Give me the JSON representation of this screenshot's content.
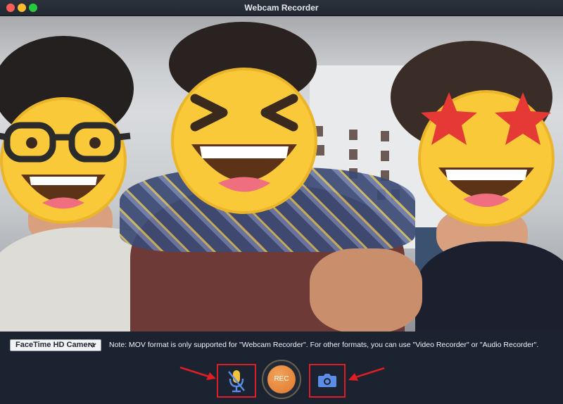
{
  "window": {
    "title": "Webcam Recorder"
  },
  "camera": {
    "selected": "FaceTime HD Camera"
  },
  "note": "Note: MOV format is only supported for \"Webcam Recorder\". For other formats, you can use \"Video Recorder\" or \"Audio Recorder\".",
  "controls": {
    "record_label": "REC",
    "mic_icon": "microphone-muted-icon",
    "snapshot_icon": "camera-icon"
  },
  "colors": {
    "accent_record": "#e8842f",
    "highlight": "#e01c24",
    "icon_blue": "#5b8de8"
  }
}
